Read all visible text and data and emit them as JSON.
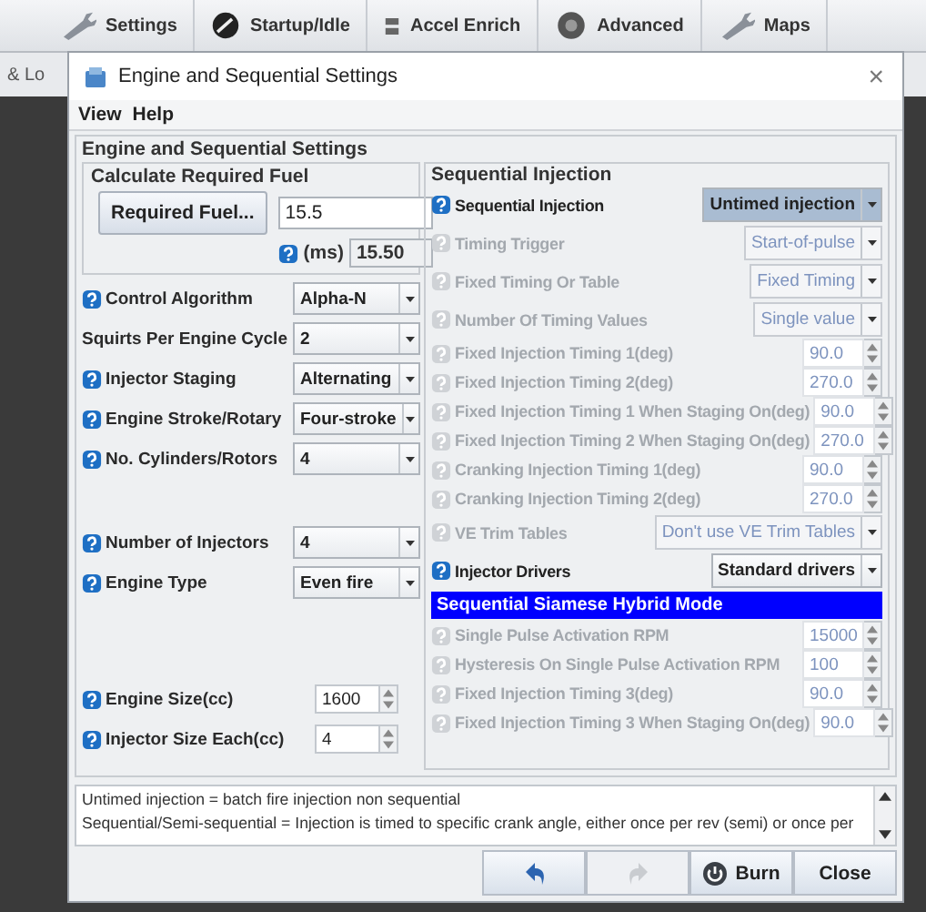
{
  "background_toolbar": [
    {
      "label": "Settings"
    },
    {
      "label": "Startup/Idle"
    },
    {
      "label": "Accel Enrich"
    },
    {
      "label": "Advanced"
    },
    {
      "label": "Maps"
    }
  ],
  "background_tab": "& Lo",
  "window": {
    "title": "Engine and Sequential Settings",
    "close": "×"
  },
  "menu": [
    {
      "label": "View"
    },
    {
      "label": "Help"
    }
  ],
  "panel_title": "Engine and Sequential Settings",
  "fuel": {
    "title": "Calculate Required Fuel",
    "button": "Required Fuel...",
    "value": "15.5",
    "unit": "(ms)",
    "result": "15.50"
  },
  "left_fields": [
    {
      "kind": "select",
      "help": true,
      "label": "Control Algorithm",
      "value": "Alpha-N"
    },
    {
      "kind": "select",
      "help": false,
      "label": "Squirts Per Engine Cycle",
      "value": "2"
    },
    {
      "kind": "select",
      "help": true,
      "label": "Injector Staging",
      "value": "Alternating"
    },
    {
      "kind": "select",
      "help": true,
      "label": "Engine Stroke/Rotary",
      "value": "Four-stroke"
    },
    {
      "kind": "select",
      "help": true,
      "label": "No. Cylinders/Rotors",
      "value": "4"
    },
    {
      "kind": "gap"
    },
    {
      "kind": "select",
      "help": true,
      "label": "Number of Injectors",
      "value": "4"
    },
    {
      "kind": "select",
      "help": true,
      "label": "Engine Type",
      "value": "Even fire"
    },
    {
      "kind": "gap"
    },
    {
      "kind": "spinner",
      "help": true,
      "label": "Engine Size(cc)",
      "value": "1600"
    },
    {
      "kind": "spinner",
      "help": true,
      "label": "Injector Size Each(cc)",
      "value": "4"
    }
  ],
  "sequential": {
    "title": "Sequential Injection",
    "rows": [
      {
        "kind": "select",
        "label": "Sequential Injection",
        "value": "Untimed injection",
        "disabled": false,
        "focused": true
      },
      {
        "kind": "select",
        "label": "Timing Trigger",
        "value": "Start-of-pulse",
        "disabled": true,
        "focused": false
      },
      {
        "kind": "select",
        "label": "Fixed Timing Or Table",
        "value": "Fixed Timing",
        "disabled": true,
        "focused": false
      },
      {
        "kind": "select",
        "label": "Number Of Timing Values",
        "value": "Single value",
        "disabled": true,
        "focused": false
      },
      {
        "kind": "spinner",
        "label": "Fixed Injection Timing 1(deg)",
        "value": "90.0",
        "disabled": true
      },
      {
        "kind": "spinner",
        "label": "Fixed Injection Timing 2(deg)",
        "value": "270.0",
        "disabled": true
      },
      {
        "kind": "spinner",
        "label": "Fixed Injection Timing 1 When Staging On(deg)",
        "value": "90.0",
        "disabled": true
      },
      {
        "kind": "spinner",
        "label": "Fixed Injection Timing 2 When Staging On(deg)",
        "value": "270.0",
        "disabled": true
      },
      {
        "kind": "spinner",
        "label": "Cranking Injection Timing 1(deg)",
        "value": "90.0",
        "disabled": true
      },
      {
        "kind": "spinner",
        "label": "Cranking Injection Timing 2(deg)",
        "value": "270.0",
        "disabled": true
      },
      {
        "kind": "select",
        "label": "VE Trim Tables",
        "value": "Don't use VE Trim Tables",
        "disabled": true,
        "focused": false
      },
      {
        "kind": "select",
        "label": "Injector Drivers",
        "value": "Standard drivers",
        "disabled": false,
        "focused": false
      },
      {
        "kind": "header",
        "label": "Sequential Siamese Hybrid Mode"
      },
      {
        "kind": "spinner",
        "label": "Single Pulse Activation RPM",
        "value": "15000",
        "disabled": true
      },
      {
        "kind": "spinner",
        "label": "Hysteresis On Single Pulse Activation RPM",
        "value": "100",
        "disabled": true
      },
      {
        "kind": "spinner",
        "label": "Fixed Injection Timing 3(deg)",
        "value": "90.0",
        "disabled": true
      },
      {
        "kind": "spinner",
        "label": "Fixed Injection Timing 3 When Staging On(deg)",
        "value": "90.0",
        "disabled": true
      }
    ]
  },
  "help_text": [
    "Untimed injection = batch fire injection non sequential",
    "Sequential/Semi-sequential = Injection is timed to specific crank angle, either once per rev (semi) or once per"
  ],
  "buttons": [
    {
      "kind": "undo",
      "disabled": false
    },
    {
      "kind": "redo",
      "disabled": true
    },
    {
      "kind": "burn",
      "label": "Burn",
      "disabled": false
    },
    {
      "kind": "close",
      "label": "Close",
      "disabled": false
    }
  ]
}
